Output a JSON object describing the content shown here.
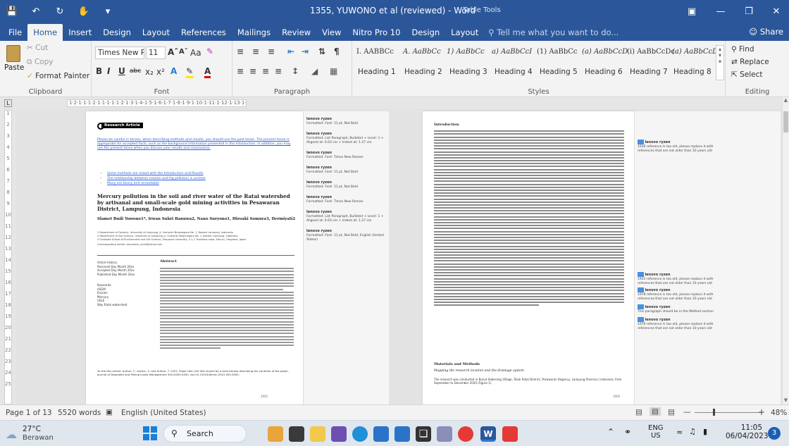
{
  "titlebar": {
    "title": "1355, YUWONO et al (reviewed) - Word",
    "context_tab": "Table Tools"
  },
  "menu": {
    "tabs": [
      "File",
      "Home",
      "Insert",
      "Design",
      "Layout",
      "References",
      "Mailings",
      "Review",
      "View",
      "Nitro Pro 10",
      "Design",
      "Layout"
    ],
    "tell_me": "Tell me what you want to do...",
    "share": "Share"
  },
  "clipboard": {
    "cut": "Cut",
    "copy": "Copy",
    "paste": "Paste",
    "format_painter": "Format Painter",
    "label": "Clipboard"
  },
  "font": {
    "name": "Times New R",
    "size": "11",
    "label": "Font"
  },
  "paragraph": {
    "label": "Paragraph"
  },
  "styles": {
    "previews": [
      "I. AABBCc",
      "A. AaBbCc",
      "1) AaBbCc",
      "a) AaBbCcI",
      "(1) AaBbCc",
      "(a) AaBbCcD",
      "(i) AaBbCcDc",
      "(a) AaBbCcD"
    ],
    "headings": [
      "Heading 1",
      "Heading 2",
      "Heading 3",
      "Heading 4",
      "Heading 5",
      "Heading 6",
      "Heading 7",
      "Heading 8"
    ],
    "label": "Styles"
  },
  "editing": {
    "find": "Find",
    "replace": "Replace",
    "select": "Select",
    "label": "Editing"
  },
  "ruler": {
    "marks": "1·2·1·1·1·2·1·1·1·1·1·2·1·3·1·4·1·5·1·6·1·7·1·8·1·9·1·10·1·11·1·12·1·13·1·14·1·15·1·16·1·17·1·18"
  },
  "vruler": [
    "1",
    "2",
    "3",
    "4",
    "5",
    "6",
    "7",
    "8",
    "9",
    "10",
    "11",
    "12",
    "13",
    "14",
    "15",
    "16",
    "17",
    "18",
    "19",
    "20",
    "21",
    "22",
    "23",
    "24",
    "25"
  ],
  "page1": {
    "heading": "Research Article",
    "note": "Please be careful in tenses, when describing methods and results, you should use the past tense. The present tense is appropriate for accepted facts, such as the background information presented in the Introduction. In addition, you may use the present tense when you discuss your results and conclusions.",
    "bullets": [
      "Some methods are mixed with the Introduction and Results",
      "The relationship between erosion and Hg pollution is unclear",
      "Many are blurry and unreadable"
    ],
    "title": "Mercury pollution in the soil and river water of the Ratai watershed by artisanal and small-scale gold mining activities in Pesawaran District, Lampung, Indonesia",
    "authors": "Slamet Budi Yuwono1*, Irwan Sukri Banuwa2, Nano Suryono1, Hiroaki Somura3, Dermiyati2",
    "affiliations": [
      "1 Department of Forestry, University of Lampung, Jl. Sumantri Brojonegoro No. 1, Bandar Lampung, Indonesia",
      "2 Department of Soil Science, University of Lampung, Jl. Sumantri Brojonegoro No. 1, Bandar Lampung, Indonesia",
      "3 Graduate School of Environment and Life Science, Okayama University, 3-1-1 Tsushima-naka, Kita-ku, Okayama, Japan"
    ],
    "corresponding": "*corresponding author: sbyuwono_unila@yahoo.com",
    "history_title": "Article history:",
    "history": [
      "Received Day Month 20xx",
      "Accepted Day Month 20xx",
      "Published Day Month 20xx"
    ],
    "keywords_title": "Keywords:",
    "keywords": [
      "ASGM",
      "Erosion",
      "Mercury",
      "USLE",
      "Way Ratai watershed"
    ],
    "abstract_title": "Abstract",
    "cite": "To cite this article: Author, F., Author, S. and Author, T. 2022. Paper title, the title should be a brief phrase describing the contents of the paper. Journal of Degraded and Mining Lands Management 9(0):0000-0000, doi:10.15243/jdmlm.2022.000.0000.",
    "pagenum": "1001"
  },
  "comments_left": [
    {
      "author": "lenovo ryzen",
      "text": "Formatted: Font: 11 pt, Not Bold"
    },
    {
      "author": "lenovo ryzen",
      "text": "Formatted: List Paragraph, Bulleted + Level: 1 + Aligned at: 0.63 cm + Indent at: 1.27 cm"
    },
    {
      "author": "lenovo ryzen",
      "text": "Formatted: Font: Times New Roman"
    },
    {
      "author": "lenovo ryzen",
      "text": "Formatted: Font: 11 pt, Not Bold"
    },
    {
      "author": "lenovo ryzen",
      "text": "Formatted: Font: 11 pt, Not Bold"
    },
    {
      "author": "lenovo ryzen",
      "text": "Formatted: Font: Times New Roman"
    },
    {
      "author": "lenovo ryzen",
      "text": "Formatted: List Paragraph, Bulleted + Level: 1 + Aligned at: 0.63 cm + Indent at: 1.27 cm"
    },
    {
      "author": "lenovo ryzen",
      "text": "Formatted: Font: 11 pt, Not Bold, English (United States)"
    }
  ],
  "page2": {
    "intro_title": "Introduction",
    "materials_title": "Materials and Methods",
    "materials_sub": "Mapping the research location and the drainage system",
    "last_para": "The research was conducted in Bunut Seberang Village, Teluk Ratai District, Pesawaran Regency, Lampung Province, Indonesia, from September to December 2020 (Figure 1).",
    "pagenum": "1002"
  },
  "comments_right": [
    {
      "author": "lenovo ryzen",
      "text": "1936 reference is too old, please replace it with references that are not older than 10 years old"
    },
    {
      "author": "lenovo ryzen",
      "text": "1931 reference is too old, please replace it with references that are not older than 10 years old"
    },
    {
      "author": "lenovo ryzen",
      "text": "1978 reference is too old, please replace it with references that are not older than 10 years old"
    },
    {
      "author": "lenovo ryzen",
      "text": "This paragraph should be in the Method section"
    },
    {
      "author": "lenovo ryzen",
      "text": "1976 reference is too old, please replace it with references that are not older than 10 years old"
    }
  ],
  "status": {
    "page": "Page 1 of 13",
    "words": "5520 words",
    "language": "English (United States)",
    "zoom": "48%"
  },
  "taskbar": {
    "temp": "27°C",
    "weather": "Berawan",
    "search": "Search",
    "lang_top": "ENG",
    "lang_bottom": "US",
    "time": "11:05",
    "date": "06/04/2023",
    "notif": "3"
  }
}
